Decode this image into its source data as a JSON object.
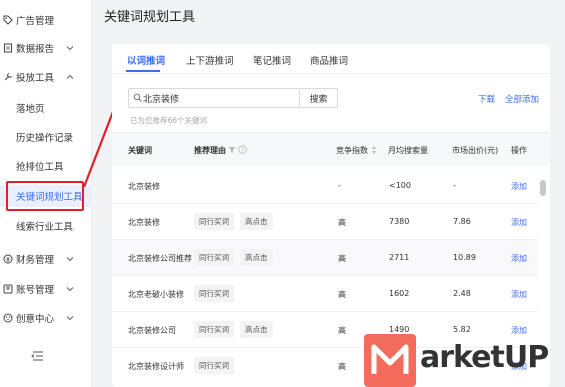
{
  "page_title": "关键词规划工具",
  "sidebar": {
    "items": [
      {
        "label": "广告管理",
        "icon": "tag-icon"
      },
      {
        "label": "数据报告",
        "icon": "report-icon"
      },
      {
        "label": "投放工具",
        "icon": "tools-icon"
      },
      {
        "label": "落地页"
      },
      {
        "label": "历史操作记录"
      },
      {
        "label": "抢排位工具"
      },
      {
        "label": "关键词规划工具"
      },
      {
        "label": "线索行业工具"
      },
      {
        "label": "财务管理",
        "icon": "finance-icon"
      },
      {
        "label": "账号管理",
        "icon": "account-icon"
      },
      {
        "label": "创意中心",
        "icon": "creative-icon"
      }
    ]
  },
  "tabs": [
    {
      "label": "以词推词"
    },
    {
      "label": "上下游推词"
    },
    {
      "label": "笔记推词"
    },
    {
      "label": "商品推词"
    }
  ],
  "search": {
    "value": "北京装修",
    "button": "搜索"
  },
  "hint": "已为您推荐66个关键词",
  "actions": {
    "download": "下载",
    "add_all": "全部添加"
  },
  "table": {
    "headers": {
      "keyword": "关键词",
      "reason": "推荐理由",
      "competition": "竞争指数",
      "monthly_search": "月均搜索量",
      "market_bid": "市场出价(元)",
      "operation": "操作"
    },
    "rows": [
      {
        "keyword": "北京装修",
        "tags": [],
        "competition": "-",
        "monthly_search": "<100",
        "market_bid": "-",
        "op": "添加"
      },
      {
        "keyword": "北京装修",
        "tags": [
          "同行买词",
          "高点击"
        ],
        "competition": "高",
        "monthly_search": "7380",
        "market_bid": "7.86",
        "op": "添加"
      },
      {
        "keyword": "北京装修公司推荐",
        "tags": [
          "同行买词",
          "高点击"
        ],
        "competition": "高",
        "monthly_search": "2711",
        "market_bid": "10.89",
        "op": "添加"
      },
      {
        "keyword": "北京老破小装修",
        "tags": [
          "同行买词"
        ],
        "competition": "高",
        "monthly_search": "1602",
        "market_bid": "2.48",
        "op": "添加"
      },
      {
        "keyword": "北京装修公司",
        "tags": [
          "同行买词",
          "高点击"
        ],
        "competition": "高",
        "monthly_search": "1490",
        "market_bid": "5.82",
        "op": "添加"
      },
      {
        "keyword": "北京装修设计师",
        "tags": [
          "同行买词"
        ],
        "competition": "高",
        "monthly_search": "",
        "market_bid": "",
        "op": "添加"
      }
    ]
  },
  "watermark": {
    "text": "arketUP"
  },
  "colors": {
    "accent": "#3d6cf0",
    "highlight": "#e0202a",
    "brand": "#f26b5b"
  }
}
